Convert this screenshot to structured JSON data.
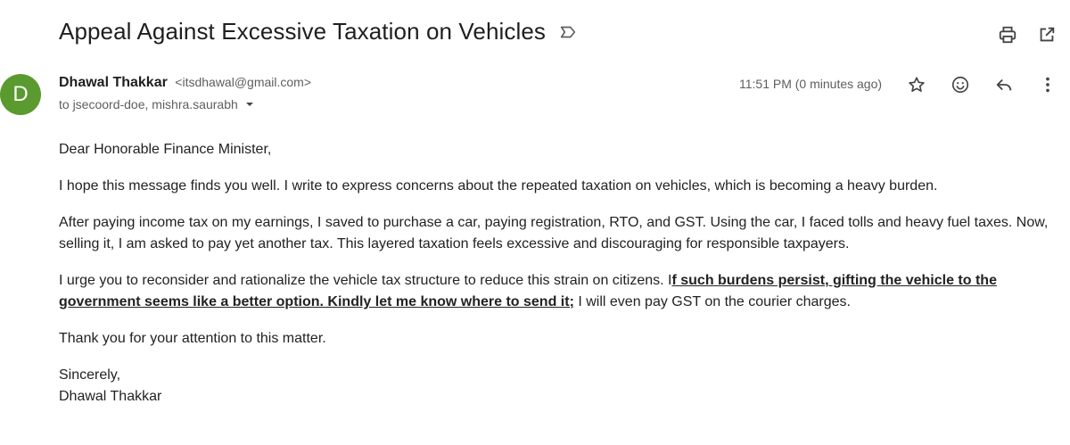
{
  "subject": "Appeal Against Excessive Taxation on Vehicles",
  "toolbar": {
    "label_icon": "label-icon",
    "print_icon": "print-icon",
    "open_new_window_icon": "open-in-new-window-icon"
  },
  "sender": {
    "avatar_letter": "D",
    "avatar_color": "#5a9a2e",
    "name": "Dhawal Thakkar",
    "email": "<itsdhawal@gmail.com>",
    "to_line": "to jsecoord-doe, mishra.saurabh"
  },
  "message_meta": {
    "timestamp": "11:51 PM (0 minutes ago)"
  },
  "body": {
    "greeting": "Dear Honorable Finance Minister,",
    "p1": "I hope this message finds you well. I write to express concerns about the repeated taxation on vehicles, which is becoming a heavy burden.",
    "p2": "After paying income tax on my earnings, I saved to purchase a car, paying registration, RTO, and GST. Using the car, I faced tolls and heavy fuel taxes. Now, selling it, I am asked to pay yet another tax. This layered taxation feels excessive and discouraging for responsible taxpayers.",
    "p3_start": "I urge you to reconsider and rationalize the vehicle tax structure to reduce this strain on citizens. I",
    "p3_emphasis": "f such burdens persist, gifting the vehicle to the government seems like a better option. Kindly let me know where to send it;",
    "p3_end": " I will even pay GST on the courier charges.",
    "thanks": "Thank you for your attention to this matter.",
    "closing": "Sincerely,",
    "signature": "Dhawal Thakkar"
  }
}
